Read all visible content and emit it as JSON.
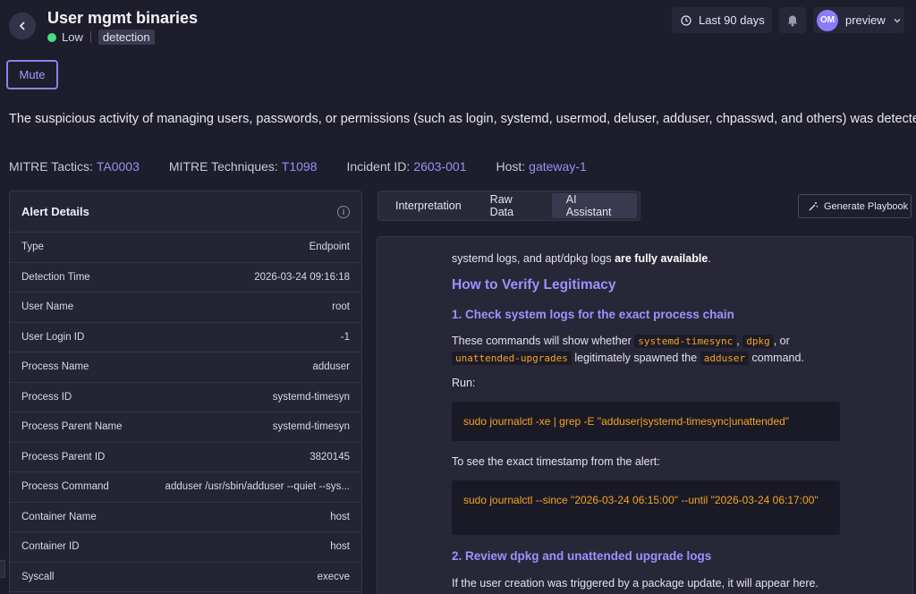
{
  "header": {
    "title": "User mgmt binaries",
    "severity": "Low",
    "tag": "detection",
    "time_range": "Last 90 days",
    "user_initials": "OM",
    "user_name": "preview"
  },
  "actions": {
    "mute": "Mute",
    "generate_playbook": "Generate Playbook"
  },
  "description": "The suspicious activity of managing users, passwords, or permissions (such as login, systemd, usermod, deluser, adduser, chpasswd, and others) was detected",
  "meta": [
    {
      "label": "MITRE Tactics:",
      "value": "TA0003"
    },
    {
      "label": "MITRE Techniques:",
      "value": "T1098"
    },
    {
      "label": "Incident ID:",
      "value": "2603-001"
    },
    {
      "label": "Host:",
      "value": "gateway-1"
    }
  ],
  "alert_details": {
    "title": "Alert Details",
    "rows": [
      {
        "k": "Type",
        "v": "Endpoint"
      },
      {
        "k": "Detection Time",
        "v": "2026-03-24 09:16:18"
      },
      {
        "k": "User Name",
        "v": "root"
      },
      {
        "k": "User Login ID",
        "v": "-1"
      },
      {
        "k": "Process Name",
        "v": "adduser"
      },
      {
        "k": "Process ID",
        "v": "systemd-timesyn"
      },
      {
        "k": "Process Parent Name",
        "v": "systemd-timesyn"
      },
      {
        "k": "Process Parent ID",
        "v": "3820145"
      },
      {
        "k": "Process Command",
        "v": "adduser /usr/sbin/adduser --quiet --sys..."
      },
      {
        "k": "Container Name",
        "v": "host"
      },
      {
        "k": "Container ID",
        "v": "host"
      },
      {
        "k": "Syscall",
        "v": "execve"
      }
    ]
  },
  "tabs": [
    "Interpretation",
    "Raw Data",
    "AI Assistant"
  ],
  "ai": {
    "p0_a": "systemd logs, and apt/dpkg logs ",
    "p0_b": "are fully available",
    "p0_c": ".",
    "h_verify": "How to Verify Legitimacy",
    "h_step1": "1. Check system logs for the exact process chain",
    "p1_a": "These commands will show whether",
    "c1": "systemd-timesync",
    "p1_b": ",",
    "c2": "dpkg",
    "p1_c": ", or",
    "c3": "unattended-upgrades",
    "p1_d": "legitimately spawned the",
    "c4": "adduser",
    "p1_e": "command.",
    "run": "Run:",
    "code1": "sudo journalctl -xe | grep -E \"adduser|systemd-timesync|unattended\"",
    "p2": "To see the exact timestamp from the alert:",
    "code2": "sudo journalctl --since \"2026-03-24 06:15:00\" --until \"2026-03-24 06:17:00\"",
    "h_step2": "2. Review dpkg and unattended upgrade logs",
    "p3": "If the user creation was triggered by a package update, it will appear here."
  }
}
